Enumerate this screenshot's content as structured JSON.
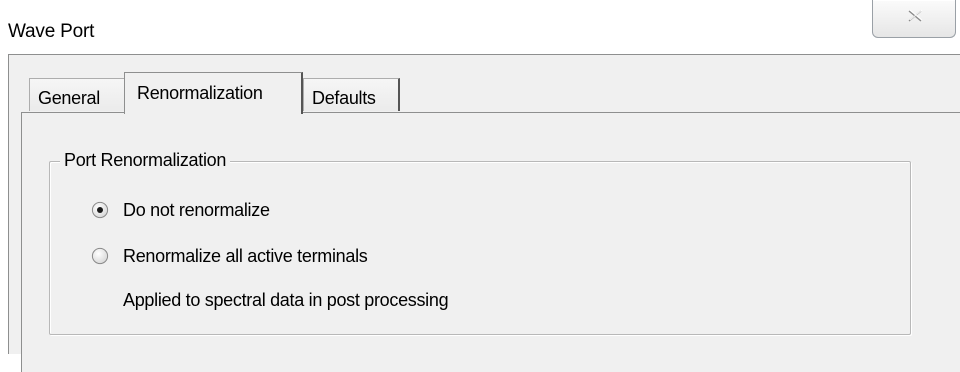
{
  "window": {
    "title": "Wave Port",
    "close_icon": "close-icon"
  },
  "tabs": [
    {
      "label": "General",
      "selected": false
    },
    {
      "label": "Renormalization",
      "selected": true
    },
    {
      "label": "Defaults",
      "selected": false
    }
  ],
  "group": {
    "title": "Port Renormalization",
    "options": [
      {
        "label": "Do not renormalize",
        "checked": true
      },
      {
        "label": "Renormalize all active terminals",
        "checked": false
      }
    ],
    "description": "Applied to spectral data in post processing"
  }
}
